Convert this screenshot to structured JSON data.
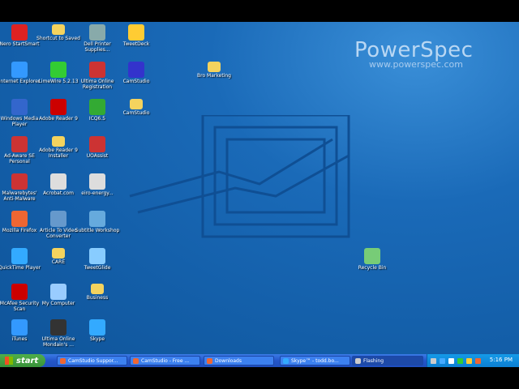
{
  "brand": {
    "name": "PowerSpec",
    "url": "www.powerspec.com"
  },
  "desktop_icons": [
    {
      "label": "Nero StartSmart",
      "color": "#d22"
    },
    {
      "label": "Shortcut to Saved",
      "color": "folder"
    },
    {
      "label": "Dell Printer Supplies...",
      "color": "#8aa"
    },
    {
      "label": "TweetDeck",
      "color": "#fc3"
    },
    {
      "label": "Internet Explorer",
      "color": "#39f"
    },
    {
      "label": "LimeWire 5.2.13",
      "color": "#3c3"
    },
    {
      "label": "Ultima Online Registration",
      "color": "#c33"
    },
    {
      "label": "CamStudio",
      "color": "#33c"
    },
    {
      "label": "Bro Marketing",
      "color": "folder"
    },
    {
      "label": "Windows Media Player",
      "color": "#36c"
    },
    {
      "label": "Adobe Reader 9",
      "color": "#c00"
    },
    {
      "label": "ICQ6.5",
      "color": "#3a3"
    },
    {
      "label": "CamStudio",
      "color": "folder"
    },
    {
      "label": "Ad-Aware SE Personal",
      "color": "#c33"
    },
    {
      "label": "Adobe Reader 9 Installer",
      "color": "folder"
    },
    {
      "label": "UOAssist",
      "color": "#c33"
    },
    {
      "label": "Malwarebytes' Anti-Malware",
      "color": "#c33"
    },
    {
      "label": "Acrobat.com",
      "color": "#ddd"
    },
    {
      "label": "eiro-energy...",
      "color": "#ddd"
    },
    {
      "label": "Mozilla Firefox",
      "color": "#e63"
    },
    {
      "label": "Article To Video Converter",
      "color": "#69c"
    },
    {
      "label": "Subtitle Workshop",
      "color": "#6ad"
    },
    {
      "label": "QuickTime Player",
      "color": "#3af"
    },
    {
      "label": "CARE",
      "color": "folder"
    },
    {
      "label": "TweetGlide",
      "color": "#8cf"
    },
    {
      "label": "Recycle Bin",
      "color": "#7c7"
    },
    {
      "label": "McAfee Security Scan",
      "color": "#c00"
    },
    {
      "label": "My Computer",
      "color": "#9cf"
    },
    {
      "label": "Business",
      "color": "folder"
    },
    {
      "label": "iTunes",
      "color": "#39f"
    },
    {
      "label": "Ultima Online Mondain's ...",
      "color": "#333"
    },
    {
      "label": "Skype",
      "color": "#3af"
    }
  ],
  "taskbar": {
    "start_label": "start",
    "tasks": [
      {
        "label": "CamStudio Suppor...",
        "color": "#e63"
      },
      {
        "label": "CamStudio - Free ...",
        "color": "#e63"
      },
      {
        "label": "Downloads",
        "color": "#e63"
      },
      {
        "label": "Skype™ - todd.bo...",
        "color": "#3af"
      },
      {
        "label": "Flashing",
        "color": "#ccc"
      }
    ],
    "clock": "5:16 PM"
  }
}
